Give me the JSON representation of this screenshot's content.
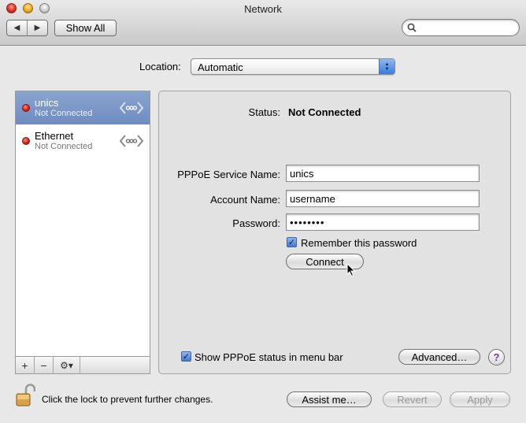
{
  "window": {
    "title": "Network"
  },
  "toolbar": {
    "back_label": "◀",
    "forward_label": "▶",
    "show_all_label": "Show All",
    "search_placeholder": ""
  },
  "location": {
    "label": "Location:",
    "value": "Automatic"
  },
  "services": [
    {
      "name": "unics",
      "status": "Not Connected",
      "selected": true
    },
    {
      "name": "Ethernet",
      "status": "Not Connected",
      "selected": false
    }
  ],
  "sidebar_controls": {
    "add": "+",
    "remove": "−",
    "gear": "⚙▾"
  },
  "detail": {
    "status_label": "Status:",
    "status_value": "Not Connected",
    "service_name_label": "PPPoE Service Name:",
    "service_name_value": "unics",
    "account_label": "Account Name:",
    "account_value": "username",
    "password_label": "Password:",
    "password_value": "••••••••",
    "remember_label": "Remember this password",
    "remember_checked": true,
    "connect_label": "Connect",
    "menu_bar_label": "Show PPPoE status in menu bar",
    "menu_bar_checked": true,
    "advanced_label": "Advanced…",
    "help_label": "?"
  },
  "footer": {
    "lock_text": "Click the lock to prevent further changes.",
    "assist_label": "Assist me…",
    "revert_label": "Revert",
    "apply_label": "Apply"
  },
  "colors": {
    "selection": "#7891c6",
    "status_red": "#d41a10",
    "check_blue": "#3f78d6"
  },
  "icons": [
    "close-icon",
    "minimize-icon",
    "zoom-icon",
    "search-icon",
    "network-icon",
    "lock-icon",
    "gear-icon",
    "cursor-icon"
  ]
}
